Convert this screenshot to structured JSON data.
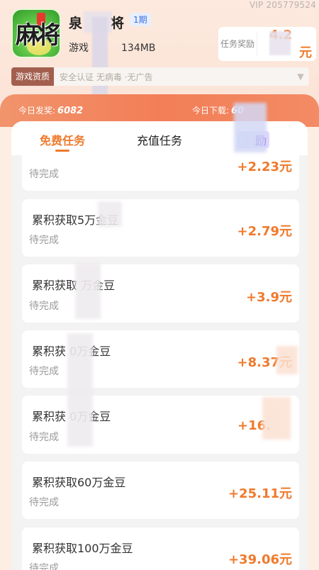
{
  "vip": "VIP 205779524",
  "app": {
    "name": "泉",
    "name_suffix": "将",
    "period_badge": "1期",
    "meta_label": "游戏",
    "meta_size": "134MB",
    "icon_text": "麻将",
    "reward_label": "任务奖励",
    "reward_amount": "4.2",
    "reward_unit": "元"
  },
  "quality": {
    "tag": "游戏资质",
    "text": "安全认证  无病毒 ·无广告"
  },
  "stats": {
    "today_reward_label": "今日发奖:",
    "today_reward_value": "6082",
    "today_download_label": "今日下载:",
    "today_download_value": "60"
  },
  "tabs": {
    "free": "免费任务",
    "recharge": "充值任务",
    "third": "励"
  },
  "tasks": [
    {
      "title": "",
      "status": "待完成",
      "amount": "+2.23元"
    },
    {
      "title": "累积获取5万金豆",
      "status": "待完成",
      "amount": "+2.79元"
    },
    {
      "title": "累积获取 万金豆",
      "status": "待完成",
      "amount": "+3.9元"
    },
    {
      "title": "累积获 0万金豆",
      "status": "待完成",
      "amount": "+8.37元"
    },
    {
      "title": "累积获 0万金豆",
      "status": "待完成",
      "amount": "+16."
    },
    {
      "title": "累积获取60万金豆",
      "status": "待完成",
      "amount": "+25.11元"
    },
    {
      "title": "累积获取100万金豆",
      "status": "待完成",
      "amount": "+39.06元"
    }
  ]
}
